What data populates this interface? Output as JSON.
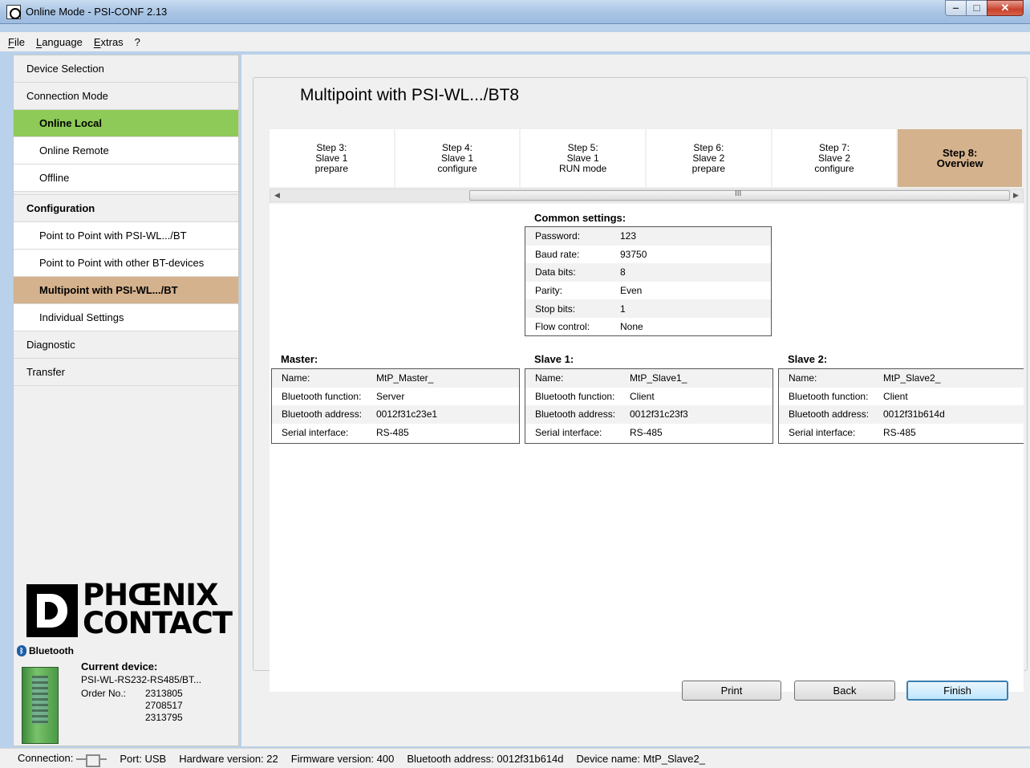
{
  "window": {
    "title": "Online Mode - PSI-CONF 2.13"
  },
  "menu": [
    "File",
    "Language",
    "Extras",
    "?"
  ],
  "sidebar": {
    "items": [
      {
        "label": "Device Selection"
      },
      {
        "label": "Connection Mode"
      },
      {
        "label": "Online Local"
      },
      {
        "label": "Online Remote"
      },
      {
        "label": "Offline"
      },
      {
        "label": "Configuration"
      },
      {
        "label": "Point to Point with PSI-WL.../BT"
      },
      {
        "label": "Point to Point with other BT-devices"
      },
      {
        "label": "Multipoint with PSI-WL.../BT"
      },
      {
        "label": "Individual Settings"
      },
      {
        "label": "Diagnostic"
      },
      {
        "label": "Transfer"
      }
    ],
    "logo_line1": "PHŒNIX",
    "logo_line2": "CONTACT",
    "bluetooth_label": "Bluetooth",
    "current_device_title": "Current device:",
    "current_device_model": "PSI-WL-RS232-RS485/BT...",
    "order_label": "Order No.:",
    "order_numbers": [
      "2313805",
      "2708517",
      "2313795"
    ]
  },
  "main": {
    "title": "Multipoint with PSI-WL.../BT8",
    "steps": [
      {
        "label": "Step 3:\nSlave 1\nprepare"
      },
      {
        "label": "Step 4:\nSlave 1\nconfigure"
      },
      {
        "label": "Step 5:\nSlave 1\nRUN mode"
      },
      {
        "label": "Step 6:\nSlave 2\nprepare"
      },
      {
        "label": "Step 7:\nSlave 2\nconfigure"
      },
      {
        "label": "Step 8:\nOverview",
        "active": true
      }
    ],
    "common": {
      "title": "Common settings:",
      "rows": [
        {
          "key": "Password:",
          "value": "123"
        },
        {
          "key": "Baud rate:",
          "value": "93750"
        },
        {
          "key": "Data bits:",
          "value": "8"
        },
        {
          "key": "Parity:",
          "value": "Even"
        },
        {
          "key": "Stop bits:",
          "value": "1"
        },
        {
          "key": "Flow control:",
          "value": "None"
        }
      ]
    },
    "devices": [
      {
        "title": "Master:",
        "rows": [
          {
            "key": "Name:",
            "value": "MtP_Master_"
          },
          {
            "key": "Bluetooth function:",
            "value": "Server"
          },
          {
            "key": "Bluetooth address:",
            "value": "0012f31c23e1"
          },
          {
            "key": "Serial interface:",
            "value": "RS-485"
          }
        ]
      },
      {
        "title": "Slave 1:",
        "rows": [
          {
            "key": "Name:",
            "value": "MtP_Slave1_"
          },
          {
            "key": "Bluetooth function:",
            "value": "Client"
          },
          {
            "key": "Bluetooth address:",
            "value": "0012f31c23f3"
          },
          {
            "key": "Serial interface:",
            "value": "RS-485"
          }
        ]
      },
      {
        "title": "Slave 2:",
        "rows": [
          {
            "key": "Name:",
            "value": "MtP_Slave2_"
          },
          {
            "key": "Bluetooth function:",
            "value": "Client"
          },
          {
            "key": "Bluetooth address:",
            "value": "0012f31b614d"
          },
          {
            "key": "Serial interface:",
            "value": "RS-485"
          }
        ]
      }
    ],
    "buttons": {
      "print": "Print",
      "back": "Back",
      "finish": "Finish"
    },
    "scroll_grip": "III"
  },
  "status": {
    "connection_label": "Connection:",
    "port": "Port: USB",
    "hardware": "Hardware version: 22",
    "firmware": "Firmware version: 400",
    "bt_address": "Bluetooth address: 0012f31b614d",
    "device_name": "Device name: MtP_Slave2_"
  },
  "colors": {
    "active_green": "#8dca58",
    "active_orange": "#d4b28d"
  }
}
